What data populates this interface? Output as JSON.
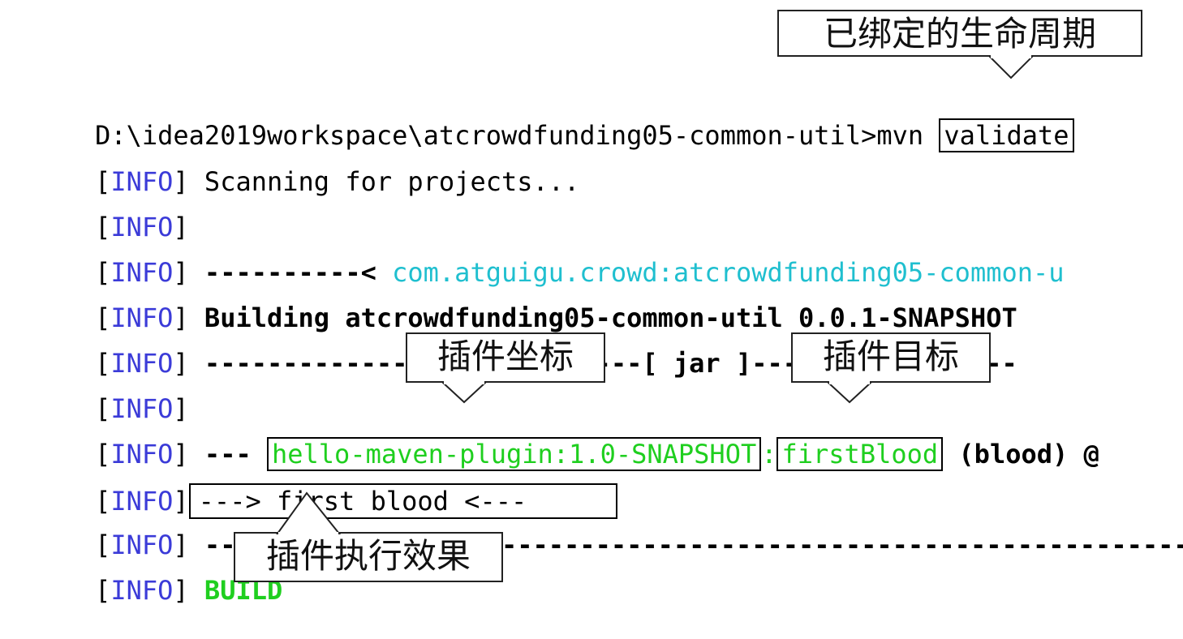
{
  "terminal": {
    "command": {
      "prompt": "D:\\idea2019workspace\\atcrowdfunding05-common-util>mvn ",
      "goal": "validate"
    },
    "tag_open": "[",
    "tag_text": "INFO",
    "tag_close": "]",
    "lines": [
      {
        "text": "Scanning for projects..."
      },
      {
        "text": ""
      },
      {
        "dashes": "----------< ",
        "coords": "com.atguigu.crowd:atcrowdfunding05-common-u"
      },
      {
        "text": "Building atcrowdfunding05-common-util 0.0.1-SNAPSHOT"
      },
      {
        "left_dashes": "----------------------------[ ",
        "packaging": "jar",
        "right": " ]-----------------"
      },
      {
        "text": ""
      },
      {
        "prefix": "--- ",
        "plugin_coords": "hello-maven-plugin:1.0-SNAPSHOT",
        "separator": ":",
        "goal": "firstBlood",
        "execution": " (blood) @"
      },
      {
        "text": "---> first blood <---"
      },
      {
        "text": "----------------------------------------------------------------"
      },
      {
        "status": "BUILD"
      }
    ]
  },
  "annotations": {
    "lifecycle_phase": "已绑定的生命周期",
    "plugin_coordinates": "插件坐标",
    "plugin_goal": "插件目标",
    "plugin_result": "插件执行效果"
  },
  "colors": {
    "info": "#3b3bd8",
    "cyan": "#1fbfcf",
    "green": "#1fcf1f"
  }
}
